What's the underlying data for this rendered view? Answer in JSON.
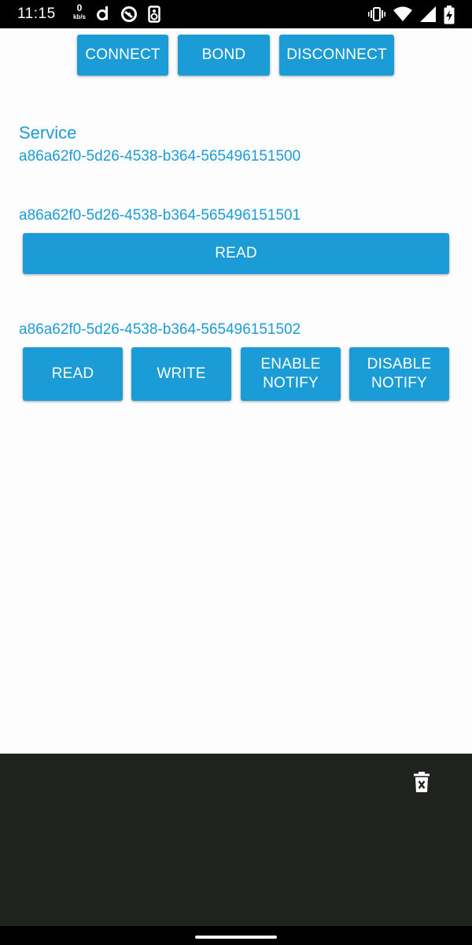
{
  "status_bar": {
    "time": "11:15",
    "net_speed_value": "0",
    "net_speed_unit": "kb/s",
    "icons": [
      "d-app-icon",
      "at-notification-icon",
      "speaker-icon",
      "vibrate-icon",
      "wifi-icon",
      "cell-signal-icon",
      "battery-charging-icon"
    ]
  },
  "top_actions": {
    "connect": "CONNECT",
    "bond": "BOND",
    "disconnect": "DISCONNECT"
  },
  "service": {
    "heading": "Service",
    "uuid": "a86a62f0-5d26-4538-b364-565496151500"
  },
  "characteristics": [
    {
      "uuid": "a86a62f0-5d26-4538-b364-565496151501",
      "actions": [
        "READ"
      ]
    },
    {
      "uuid": "a86a62f0-5d26-4538-b364-565496151502",
      "actions": [
        "READ",
        "WRITE",
        "ENABLE\nNOTIFY",
        "DISABLE\nNOTIFY"
      ]
    }
  ],
  "log_panel": {
    "clear_icon": "trash-delete-icon"
  },
  "colors": {
    "accent": "#1b9cd6",
    "panel": "#1f221f",
    "background": "#fdfdfd"
  }
}
